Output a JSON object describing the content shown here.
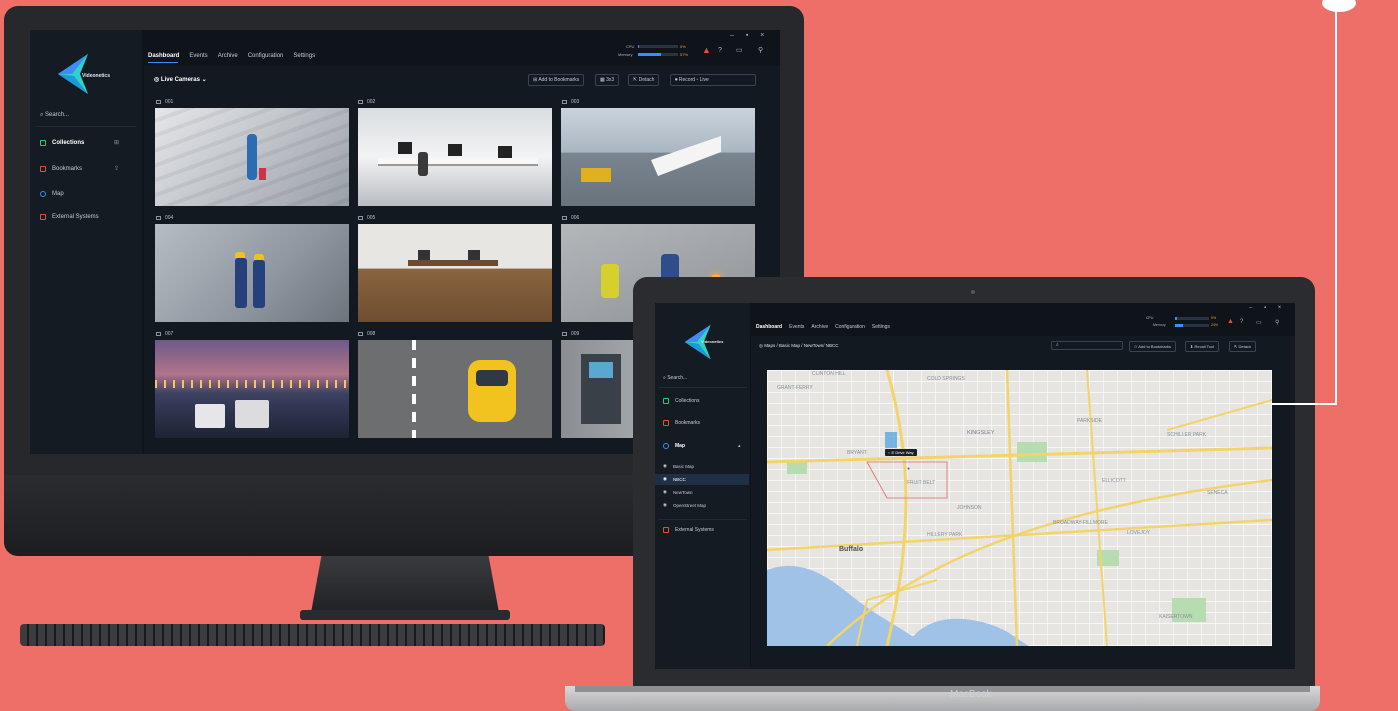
{
  "desktop": {
    "app": {
      "logo_text": "Videonetics",
      "search_placeholder": "Search..."
    },
    "nav": {
      "tabs": [
        "Dashboard",
        "Events",
        "Archive",
        "Configuration",
        "Settings"
      ]
    },
    "sidebar": {
      "items": [
        {
          "label": "Collections",
          "color": "#2ecc71"
        },
        {
          "label": "Bookmarks",
          "color": "#e74c3c"
        },
        {
          "label": "Map",
          "color": "#3d8bfd"
        },
        {
          "label": "External Systems",
          "color": "#e74c3c"
        }
      ]
    },
    "stats": {
      "cpu_label": "CPU",
      "cpu_value": "0%",
      "cpu_fraction": 0.02,
      "memory_label": "Memory",
      "memory_value": "57%",
      "memory_fraction": 0.57
    },
    "toolbar": {
      "title": "Live Cameras",
      "add_bookmark": "Add to Bookmarks",
      "layout": "3x3",
      "detach": "Detach",
      "record": "Record",
      "live": "Live"
    },
    "cameras": [
      {
        "id": "001"
      },
      {
        "id": "002"
      },
      {
        "id": "003"
      },
      {
        "id": "004"
      },
      {
        "id": "005"
      },
      {
        "id": "006"
      },
      {
        "id": "007"
      },
      {
        "id": "008"
      },
      {
        "id": "009"
      }
    ]
  },
  "laptop": {
    "app": {
      "logo_text": "Videonetics",
      "search_placeholder": "Search..."
    },
    "nav": {
      "tabs": [
        "Dashboard",
        "Events",
        "Archive",
        "Configuration",
        "Settings"
      ]
    },
    "stats": {
      "cpu_label": "CPU",
      "cpu_value": "5%",
      "cpu_fraction": 0.05,
      "memory_label": "Memory",
      "memory_value": "24%",
      "memory_fraction": 0.24
    },
    "breadcrumb": "Maps / Basic Map / NewTown/ NBCC",
    "buttons": {
      "bookmark": "Add to Bookmarks",
      "recall": "Recall Tool",
      "detach": "Detach"
    },
    "sidebar": {
      "items": [
        {
          "label": "Collections",
          "color": "#2ecc71"
        },
        {
          "label": "Bookmarks",
          "color": "#e74c3c"
        },
        {
          "label": "Map",
          "color": "#3d8bfd"
        }
      ],
      "map_children": [
        "Basic Map",
        "NBCC",
        "NewTown",
        "OpenStreet Map"
      ],
      "external": "External Systems"
    },
    "map": {
      "labels": [
        "CLINTON HILL",
        "COLD SPRINGS",
        "GRANT-FERRY",
        "KINGSLEY",
        "BRYANT",
        "FRUIT BELT",
        "JOHNSON",
        "BROADWAY-FILLMORE",
        "ELLICOTT",
        "HILLERY PARK",
        "LOVEJOY",
        "Buffalo",
        "KAISERTOWN",
        "SCHILLER PARK",
        "PARKSIDE",
        "SENECA"
      ],
      "marker_label": "E Drive Way"
    },
    "brand": "MacBook"
  },
  "colors": {
    "accent": "#3d8bfd",
    "alert": "#e74c3c",
    "background": "#ee6e68"
  }
}
